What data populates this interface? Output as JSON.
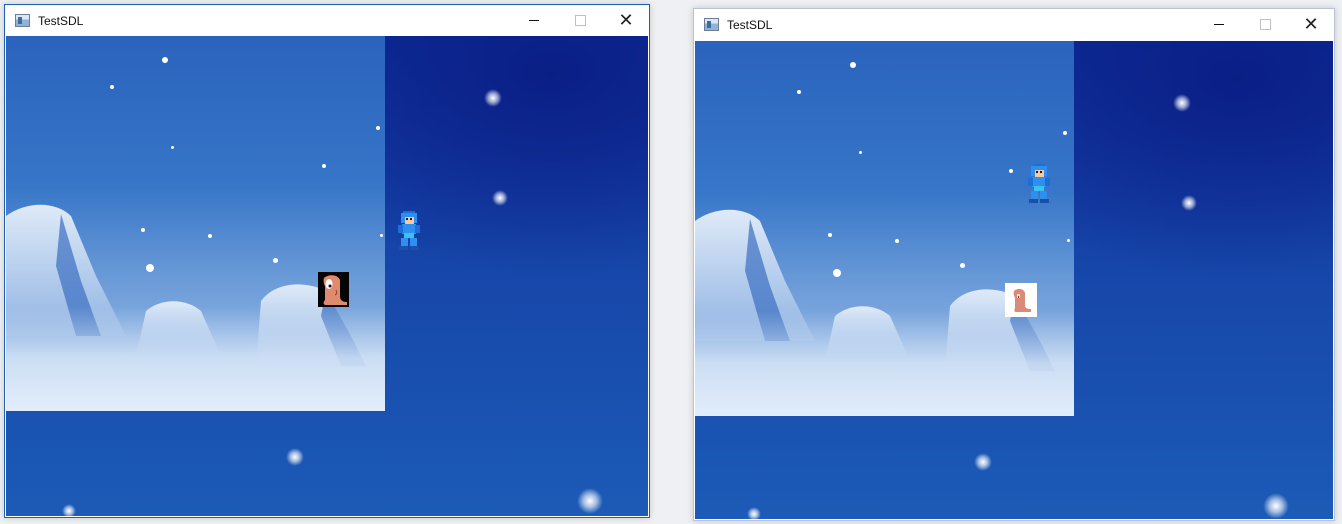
{
  "windows": [
    {
      "title": "TestSDL",
      "controls": {
        "minimize": "minimize",
        "maximize": "maximize",
        "close": "close"
      }
    },
    {
      "title": "TestSDL",
      "controls": {
        "minimize": "minimize",
        "maximize": "maximize",
        "close": "close"
      }
    }
  ],
  "icons": {
    "app": "app-window-icon",
    "minimize": "minimize-icon",
    "maximize": "maximize-icon",
    "close": "close-icon",
    "hero": "megaman-sprite",
    "worm": "worm-sprite"
  },
  "colors": {
    "sky_dark": "#0e2c9a",
    "sky_light": "#1c5bb7",
    "scene_sky": "#2a63bd",
    "ice": "#a8c5ea",
    "title_bar": "#ffffff"
  }
}
